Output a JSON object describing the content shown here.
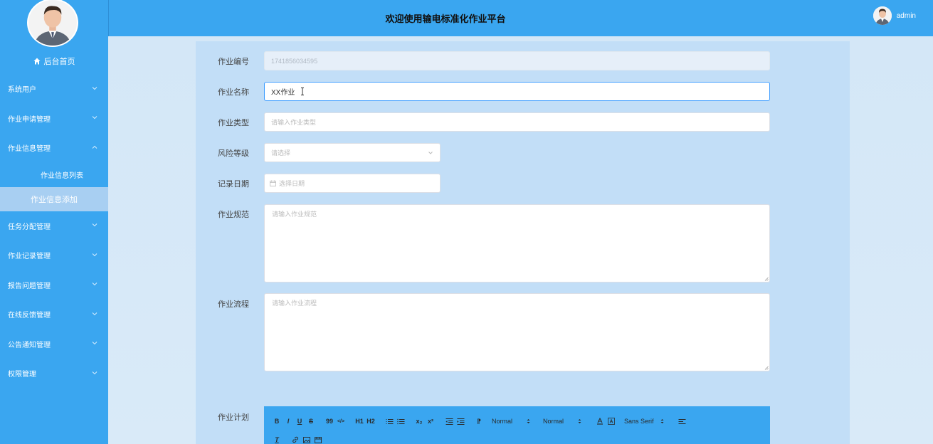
{
  "sidebar": {
    "home_label": "后台首页",
    "menu": [
      {
        "label": "系统用户",
        "expanded": false
      },
      {
        "label": "作业申请管理",
        "expanded": false
      },
      {
        "label": "作业信息管理",
        "expanded": true
      },
      {
        "label": "任务分配管理",
        "expanded": false
      },
      {
        "label": "作业记录管理",
        "expanded": false
      },
      {
        "label": "报告问题管理",
        "expanded": false
      },
      {
        "label": "在线反馈管理",
        "expanded": false
      },
      {
        "label": "公告通知管理",
        "expanded": false
      },
      {
        "label": "权限管理",
        "expanded": false
      }
    ],
    "submenu": [
      {
        "label": "作业信息列表",
        "active": false
      },
      {
        "label": "作业信息添加",
        "active": true
      }
    ]
  },
  "header": {
    "title": "欢迎使用输电标准化作业平台",
    "username": "admin"
  },
  "form": {
    "job_no": {
      "label": "作业编号",
      "value": "1741856034595"
    },
    "job_name": {
      "label": "作业名称",
      "value": "XX作业"
    },
    "job_type": {
      "label": "作业类型",
      "placeholder": "请输入作业类型"
    },
    "risk_level": {
      "label": "风险等级",
      "placeholder": "请选择"
    },
    "record_date": {
      "label": "记录日期",
      "placeholder": "选择日期"
    },
    "job_spec": {
      "label": "作业规范",
      "placeholder": "请输入作业规范"
    },
    "job_process": {
      "label": "作业流程",
      "placeholder": "请输入作业流程"
    },
    "job_plan": {
      "label": "作业计划"
    }
  },
  "editor_toolbar": {
    "header_select": "Normal",
    "size_select": "Normal",
    "font_select": "Sans Serif",
    "bold": "B",
    "italic": "I",
    "underline": "U",
    "strike": "S",
    "blockquote": "99",
    "code": "</>",
    "h1": "H1",
    "h2": "H2",
    "sub": "x₂",
    "sup": "x²",
    "rtl": "⁋",
    "clean": "T"
  },
  "colors": {
    "primary": "#3aa6f0",
    "active_submenu": "#a8cff2",
    "panel": "#c2def7",
    "focus_border": "#409eff"
  }
}
